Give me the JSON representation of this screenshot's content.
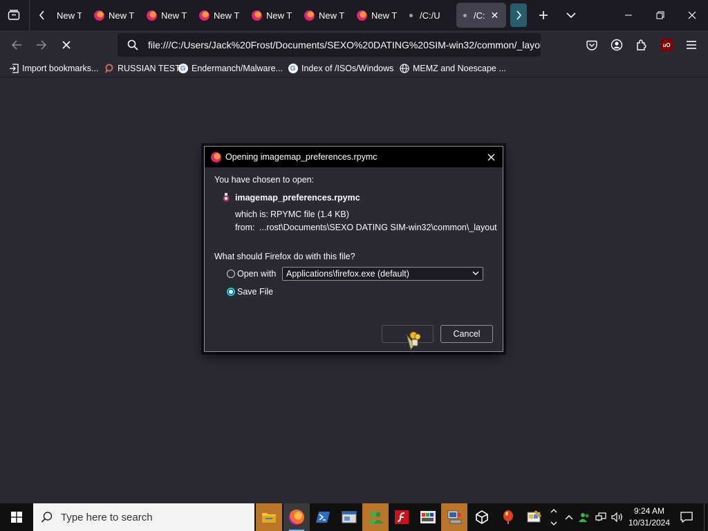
{
  "browser": {
    "tabs": [
      {
        "label": "New T",
        "type": "firefox"
      },
      {
        "label": "New T",
        "type": "firefox"
      },
      {
        "label": "New T",
        "type": "firefox"
      },
      {
        "label": "New T",
        "type": "firefox"
      },
      {
        "label": "New T",
        "type": "firefox"
      },
      {
        "label": "New T",
        "type": "firefox"
      },
      {
        "label": "/C:/U",
        "type": "file"
      },
      {
        "label": "/C:",
        "type": "file",
        "active": true
      }
    ],
    "url": "file:///C:/Users/Jack%20Frost/Documents/SEXO%20DATING%20SIM-win32/common/_layou",
    "bookmarks": [
      {
        "label": "Import bookmarks...",
        "icon": "import-icon"
      },
      {
        "label": "RUSSIAN TEST",
        "icon": "russian-icon"
      },
      {
        "label": "Endermanch/Malware...",
        "icon": "google-icon"
      },
      {
        "label": "Index of /ISOs/Windows",
        "icon": "google-icon"
      },
      {
        "label": "MEMZ and Noescape ...",
        "icon": "globe-icon"
      }
    ]
  },
  "dialog": {
    "title": "Opening imagemap_preferences.rpymc",
    "chosen_label": "You have chosen to open:",
    "filename": "imagemap_preferences.rpymc",
    "which_is_label": "which is:",
    "which_is_value": "RPYMC file (1.4 KB)",
    "from_label": "from:",
    "from_value": "...rost\\Documents\\SEXO DATING SIM-win32\\common\\_layout",
    "question": "What should Firefox do with this file?",
    "open_with_label": "Open with",
    "open_with_app": "Applications\\firefox.exe (default)",
    "save_file_label": "Save File",
    "selected_option": "save",
    "ok_label": "",
    "cancel_label": "Cancel"
  },
  "taskbar": {
    "search_placeholder": "Type here to search",
    "time": "9:24 AM",
    "date": "10/31/2024"
  },
  "colors": {
    "toolbar_bg": "#2b2a33",
    "tabstrip_bg": "#1c1b22",
    "accent": "#00ddff",
    "taskbar_highlight": "#b97529"
  }
}
